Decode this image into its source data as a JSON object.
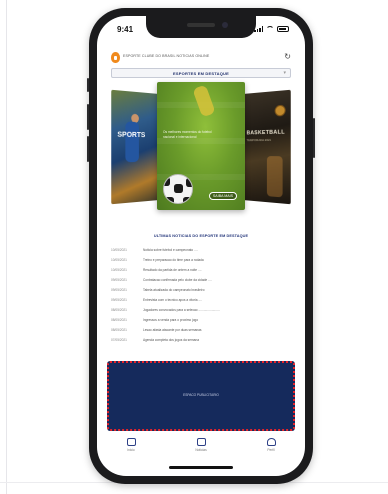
{
  "status_bar": {
    "time": "9:41"
  },
  "app_bar": {
    "title": "ESPORTE CLUBE DO BRASIL NOTICIAS ONLINE",
    "refresh_icon": "refresh-icon"
  },
  "section_bar": {
    "label": "ESPORTES EM DESTAQUE"
  },
  "carousel": {
    "left_card_text": "SPORTS",
    "center_card_caption": "Os melhores momentos do futebol nacional e internacional",
    "center_card_button": "SAIBA MAIS",
    "right_card_title": "BASKETBALL",
    "right_card_subtitle": "TEMPORADA 2021"
  },
  "list": {
    "title": "ULTIMAS NOTICIAS DO ESPORTE EM DESTAQUE",
    "rows": [
      {
        "date": "10/05/2021",
        "text": "Noticia sobre futebol e campeonato ...."
      },
      {
        "date": "10/05/2021",
        "text": "Treino e preparacao do time para a rodada"
      },
      {
        "date": "10/05/2021",
        "text": "Resultado da partida de ontem a noite ...."
      },
      {
        "date": "09/05/2021",
        "text": "Contratacao confirmada pelo clube da cidade ...."
      },
      {
        "date": "09/05/2021",
        "text": "Tabela atualizada do campeonato brasileiro"
      },
      {
        "date": "09/05/2021",
        "text": "Entrevista com o tecnico apos a vitoria ...."
      },
      {
        "date": "08/05/2021",
        "text": "Jogadores convocados para a selecao ........................"
      },
      {
        "date": "08/05/2021",
        "text": "Ingressos a venda para o proximo jogo"
      },
      {
        "date": "08/05/2021",
        "text": "Lesao afasta atacante por duas semanas"
      },
      {
        "date": "07/05/2021",
        "text": "Agenda completa dos jogos da semana"
      }
    ]
  },
  "ad_banner": {
    "text": "ESPACO PUBLICITARIO"
  },
  "bottom_nav": {
    "items": [
      {
        "label": "Inicio",
        "icon": "home-icon"
      },
      {
        "label": "Noticias",
        "icon": "news-icon"
      },
      {
        "label": "Perfil",
        "icon": "profile-icon"
      }
    ]
  },
  "colors": {
    "accent_navy": "#23357a",
    "ad_background": "#152a5c",
    "ad_border": "#e6232a",
    "logo_orange": "#f08a1d"
  }
}
